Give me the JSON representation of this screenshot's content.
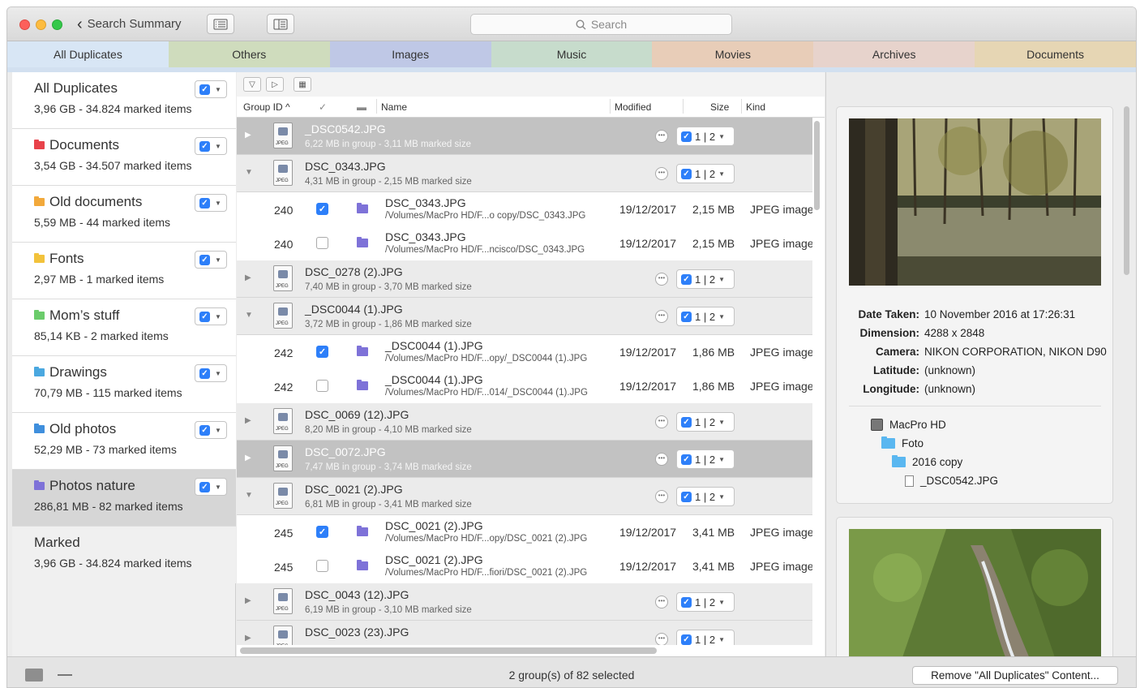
{
  "window": {
    "back_label": "Search Summary",
    "search_placeholder": "Search"
  },
  "tabs": [
    "All Duplicates",
    "Others",
    "Images",
    "Music",
    "Movies",
    "Archives",
    "Documents"
  ],
  "sidebar": [
    {
      "title": "All Duplicates",
      "sub": "3,96 GB - 34.824 marked items",
      "color": ""
    },
    {
      "title": "Documents",
      "sub": "3,54 GB - 34.507 marked items",
      "color": "#e8424a"
    },
    {
      "title": "Old documents",
      "sub": "5,59 MB - 44 marked items",
      "color": "#f2a93b"
    },
    {
      "title": "Fonts",
      "sub": "2,97 MB - 1 marked items",
      "color": "#f2c23b"
    },
    {
      "title": "Mom’s stuff",
      "sub": "85,14 KB - 2 marked items",
      "color": "#6bcc6b"
    },
    {
      "title": "Drawings",
      "sub": "70,79 MB - 115 marked items",
      "color": "#4aa8e0"
    },
    {
      "title": "Old photos",
      "sub": "52,29 MB - 73 marked items",
      "color": "#3f8fdd"
    },
    {
      "title": "Photos nature",
      "sub": "286,81 MB - 82 marked items",
      "color": "#7e72d8"
    },
    {
      "title": "Marked",
      "sub": "3,96 GB - 34.824 marked items",
      "color": ""
    }
  ],
  "columns": {
    "group_id": "Group ID",
    "name": "Name",
    "modified": "Modified",
    "size": "Size",
    "kind": "Kind"
  },
  "groups": [
    {
      "name": "_DSC0542.JPG",
      "sub": "6,22 MB in group - 3,11 MB marked size",
      "count": "1 | 2",
      "selected": true,
      "expanded": false
    },
    {
      "name": "DSC_0343.JPG",
      "sub": "4,31 MB in group - 2,15 MB marked size",
      "count": "1 | 2",
      "selected": false,
      "expanded": true
    },
    {
      "name": "DSC_0278 (2).JPG",
      "sub": "7,40 MB in group - 3,70 MB marked size",
      "count": "1 | 2",
      "selected": false,
      "expanded": false
    },
    {
      "name": "_DSC0044 (1).JPG",
      "sub": "3,72 MB in group - 1,86 MB marked size",
      "count": "1 | 2",
      "selected": false,
      "expanded": true
    },
    {
      "name": "DSC_0069 (12).JPG",
      "sub": "8,20 MB in group - 4,10 MB marked size",
      "count": "1 | 2",
      "selected": false,
      "expanded": false
    },
    {
      "name": "DSC_0072.JPG",
      "sub": "7,47 MB in group - 3,74 MB marked size",
      "count": "1 | 2",
      "selected": true,
      "expanded": false
    },
    {
      "name": "DSC_0021 (2).JPG",
      "sub": "6,81 MB in group - 3,41 MB marked size",
      "count": "1 | 2",
      "selected": false,
      "expanded": true
    },
    {
      "name": "DSC_0043 (12).JPG",
      "sub": "6,19 MB in group - 3,10 MB marked size",
      "count": "1 | 2",
      "selected": false,
      "expanded": false
    },
    {
      "name": "DSC_0023 (23).JPG",
      "sub": "",
      "count": "1 | 2",
      "selected": false,
      "expanded": false
    }
  ],
  "files": [
    {
      "group_id": "240",
      "checked": true,
      "name": "DSC_0343.JPG",
      "path": "/Volumes/MacPro HD/F...o copy/DSC_0343.JPG",
      "modified": "19/12/2017",
      "size": "2,15 MB",
      "kind": "JPEG image"
    },
    {
      "group_id": "240",
      "checked": false,
      "name": "DSC_0343.JPG",
      "path": "/Volumes/MacPro HD/F...ncisco/DSC_0343.JPG",
      "modified": "19/12/2017",
      "size": "2,15 MB",
      "kind": "JPEG image"
    },
    {
      "group_id": "242",
      "checked": true,
      "name": "_DSC0044 (1).JPG",
      "path": "/Volumes/MacPro HD/F...opy/_DSC0044 (1).JPG",
      "modified": "19/12/2017",
      "size": "1,86 MB",
      "kind": "JPEG image"
    },
    {
      "group_id": "242",
      "checked": false,
      "name": "_DSC0044 (1).JPG",
      "path": "/Volumes/MacPro HD/F...014/_DSC0044 (1).JPG",
      "modified": "19/12/2017",
      "size": "1,86 MB",
      "kind": "JPEG image"
    },
    {
      "group_id": "245",
      "checked": true,
      "name": "DSC_0021 (2).JPG",
      "path": "/Volumes/MacPro HD/F...opy/DSC_0021 (2).JPG",
      "modified": "19/12/2017",
      "size": "3,41 MB",
      "kind": "JPEG image"
    },
    {
      "group_id": "245",
      "checked": false,
      "name": "DSC_0021 (2).JPG",
      "path": "/Volumes/MacPro HD/F...fiori/DSC_0021 (2).JPG",
      "modified": "19/12/2017",
      "size": "3,41 MB",
      "kind": "JPEG image"
    }
  ],
  "details": {
    "date_taken_label": "Date Taken:",
    "date_taken": "10 November 2016 at 17:26:31",
    "dimension_label": "Dimension:",
    "dimension": "4288 x 2848",
    "camera_label": "Camera:",
    "camera": "NIKON CORPORATION, NIKON D90",
    "latitude_label": "Latitude:",
    "latitude": "(unknown)",
    "longitude_label": "Longitude:",
    "longitude": "(unknown)",
    "path": [
      "MacPro HD",
      "Foto",
      "2016 copy",
      "_DSC0542.JPG"
    ]
  },
  "status": {
    "message": "2 group(s) of 82 selected",
    "remove_label": "Remove \"All Duplicates\" Content..."
  }
}
